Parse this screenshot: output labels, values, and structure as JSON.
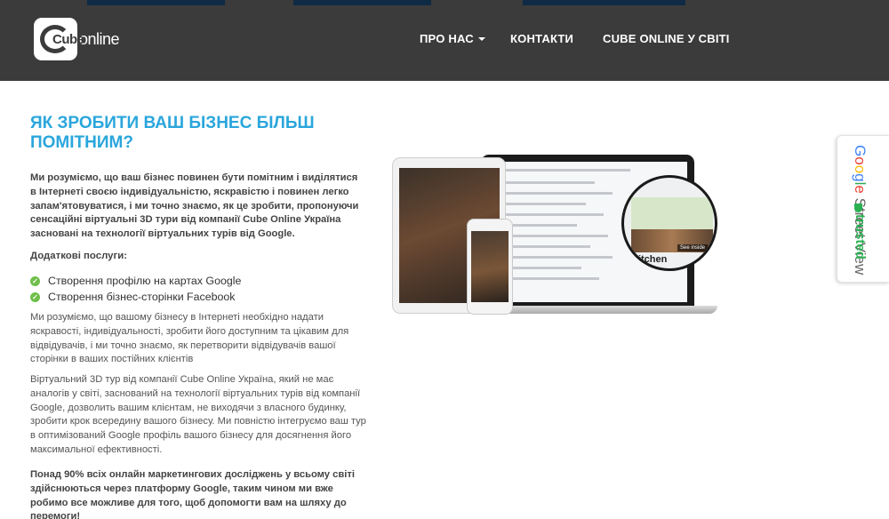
{
  "header": {
    "logo_text": "online",
    "logo_mark": "Cube",
    "nav": [
      {
        "label": "ПРО НАС",
        "has_dropdown": true
      },
      {
        "label": "КОНТАКТИ",
        "has_dropdown": false
      },
      {
        "label": "CUBE ONLINE У СВІТІ",
        "has_dropdown": false
      }
    ]
  },
  "main": {
    "title": "ЯК ЗРОБИТИ ВАШ БІЗНЕС БІЛЬШ ПОМІТНИМ?",
    "intro": "Ми розуміємо, що ваш бізнес повинен бути помітним і виділятися в Інтернеті своєю індивідуальністю, яскравістю і повинен легко запам'ятовуватися, і ми точно знаємо, як це зробити, пропонуючи сенсаційні віртуальні 3D  тури від компанії Cube Online Україна засновані на технології віртуальних турів від Google.",
    "services_heading": "Додаткові послуги:",
    "services": [
      "Створення профілю на картах Google",
      "Створення бізнес-сторінки Facebook"
    ],
    "para2": "Ми розуміємо, що вашому бізнесу в Інтернеті необхідно надати яскравості, індивідуальності, зробити його доступним та цікавим для відвідувачів, і ми точно знаємо, як перетворити відвідувачів вашої сторінки в ваших постійних клієнтів",
    "para3": "Віртуальний 3D тур від компанії Cube Online Україна, який не має аналогів у світі, заснований на технології віртуальних турів від компанії Google, дозволить вашим клієнтам, не виходячи з власного будинку, зробити крок всередину вашого бізнесу. Ми повністю інтегруємо ваш тур в оптимізований Google профіль вашого бізнесу для досягнення його максимальної ефективності.",
    "para4": "Понад 90% всіх онлайн маркетингових досліджень у всьому світі здійснюються через платформу Google, таким  чином ми вже робимо все можливе для того, щоб  допомогти вам на шляху до перемоги!"
  },
  "illustration": {
    "magnifier_label": "Kitchen",
    "magnifier_badge": "See inside"
  },
  "badge": {
    "google": [
      "G",
      "o",
      "o",
      "g",
      "l",
      "e"
    ],
    "street_view": "Street View",
    "trusted": "trusted"
  },
  "colors": {
    "header_bg": "#3b3b3b",
    "title": "#2aa6dc",
    "check": "#6fbf4a",
    "trusted": "#2bb052"
  }
}
